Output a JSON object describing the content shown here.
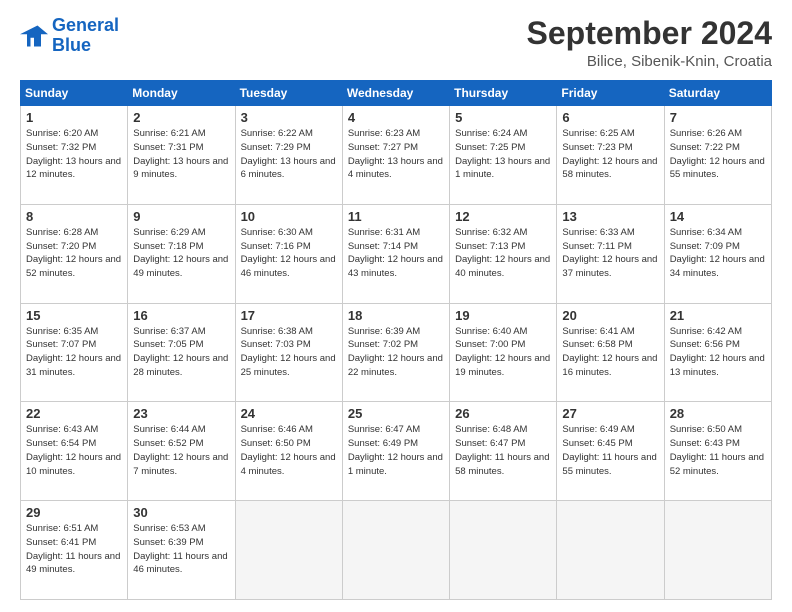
{
  "logo": {
    "line1": "General",
    "line2": "Blue"
  },
  "title": "September 2024",
  "location": "Bilice, Sibenik-Knin, Croatia",
  "days_of_week": [
    "Sunday",
    "Monday",
    "Tuesday",
    "Wednesday",
    "Thursday",
    "Friday",
    "Saturday"
  ],
  "weeks": [
    [
      {
        "day": "1",
        "sunrise": "6:20 AM",
        "sunset": "7:32 PM",
        "daylight": "13 hours and 12 minutes."
      },
      {
        "day": "2",
        "sunrise": "6:21 AM",
        "sunset": "7:31 PM",
        "daylight": "13 hours and 9 minutes."
      },
      {
        "day": "3",
        "sunrise": "6:22 AM",
        "sunset": "7:29 PM",
        "daylight": "13 hours and 6 minutes."
      },
      {
        "day": "4",
        "sunrise": "6:23 AM",
        "sunset": "7:27 PM",
        "daylight": "13 hours and 4 minutes."
      },
      {
        "day": "5",
        "sunrise": "6:24 AM",
        "sunset": "7:25 PM",
        "daylight": "13 hours and 1 minute."
      },
      {
        "day": "6",
        "sunrise": "6:25 AM",
        "sunset": "7:23 PM",
        "daylight": "12 hours and 58 minutes."
      },
      {
        "day": "7",
        "sunrise": "6:26 AM",
        "sunset": "7:22 PM",
        "daylight": "12 hours and 55 minutes."
      }
    ],
    [
      {
        "day": "8",
        "sunrise": "6:28 AM",
        "sunset": "7:20 PM",
        "daylight": "12 hours and 52 minutes."
      },
      {
        "day": "9",
        "sunrise": "6:29 AM",
        "sunset": "7:18 PM",
        "daylight": "12 hours and 49 minutes."
      },
      {
        "day": "10",
        "sunrise": "6:30 AM",
        "sunset": "7:16 PM",
        "daylight": "12 hours and 46 minutes."
      },
      {
        "day": "11",
        "sunrise": "6:31 AM",
        "sunset": "7:14 PM",
        "daylight": "12 hours and 43 minutes."
      },
      {
        "day": "12",
        "sunrise": "6:32 AM",
        "sunset": "7:13 PM",
        "daylight": "12 hours and 40 minutes."
      },
      {
        "day": "13",
        "sunrise": "6:33 AM",
        "sunset": "7:11 PM",
        "daylight": "12 hours and 37 minutes."
      },
      {
        "day": "14",
        "sunrise": "6:34 AM",
        "sunset": "7:09 PM",
        "daylight": "12 hours and 34 minutes."
      }
    ],
    [
      {
        "day": "15",
        "sunrise": "6:35 AM",
        "sunset": "7:07 PM",
        "daylight": "12 hours and 31 minutes."
      },
      {
        "day": "16",
        "sunrise": "6:37 AM",
        "sunset": "7:05 PM",
        "daylight": "12 hours and 28 minutes."
      },
      {
        "day": "17",
        "sunrise": "6:38 AM",
        "sunset": "7:03 PM",
        "daylight": "12 hours and 25 minutes."
      },
      {
        "day": "18",
        "sunrise": "6:39 AM",
        "sunset": "7:02 PM",
        "daylight": "12 hours and 22 minutes."
      },
      {
        "day": "19",
        "sunrise": "6:40 AM",
        "sunset": "7:00 PM",
        "daylight": "12 hours and 19 minutes."
      },
      {
        "day": "20",
        "sunrise": "6:41 AM",
        "sunset": "6:58 PM",
        "daylight": "12 hours and 16 minutes."
      },
      {
        "day": "21",
        "sunrise": "6:42 AM",
        "sunset": "6:56 PM",
        "daylight": "12 hours and 13 minutes."
      }
    ],
    [
      {
        "day": "22",
        "sunrise": "6:43 AM",
        "sunset": "6:54 PM",
        "daylight": "12 hours and 10 minutes."
      },
      {
        "day": "23",
        "sunrise": "6:44 AM",
        "sunset": "6:52 PM",
        "daylight": "12 hours and 7 minutes."
      },
      {
        "day": "24",
        "sunrise": "6:46 AM",
        "sunset": "6:50 PM",
        "daylight": "12 hours and 4 minutes."
      },
      {
        "day": "25",
        "sunrise": "6:47 AM",
        "sunset": "6:49 PM",
        "daylight": "12 hours and 1 minute."
      },
      {
        "day": "26",
        "sunrise": "6:48 AM",
        "sunset": "6:47 PM",
        "daylight": "11 hours and 58 minutes."
      },
      {
        "day": "27",
        "sunrise": "6:49 AM",
        "sunset": "6:45 PM",
        "daylight": "11 hours and 55 minutes."
      },
      {
        "day": "28",
        "sunrise": "6:50 AM",
        "sunset": "6:43 PM",
        "daylight": "11 hours and 52 minutes."
      }
    ],
    [
      {
        "day": "29",
        "sunrise": "6:51 AM",
        "sunset": "6:41 PM",
        "daylight": "11 hours and 49 minutes."
      },
      {
        "day": "30",
        "sunrise": "6:53 AM",
        "sunset": "6:39 PM",
        "daylight": "11 hours and 46 minutes."
      },
      null,
      null,
      null,
      null,
      null
    ]
  ]
}
